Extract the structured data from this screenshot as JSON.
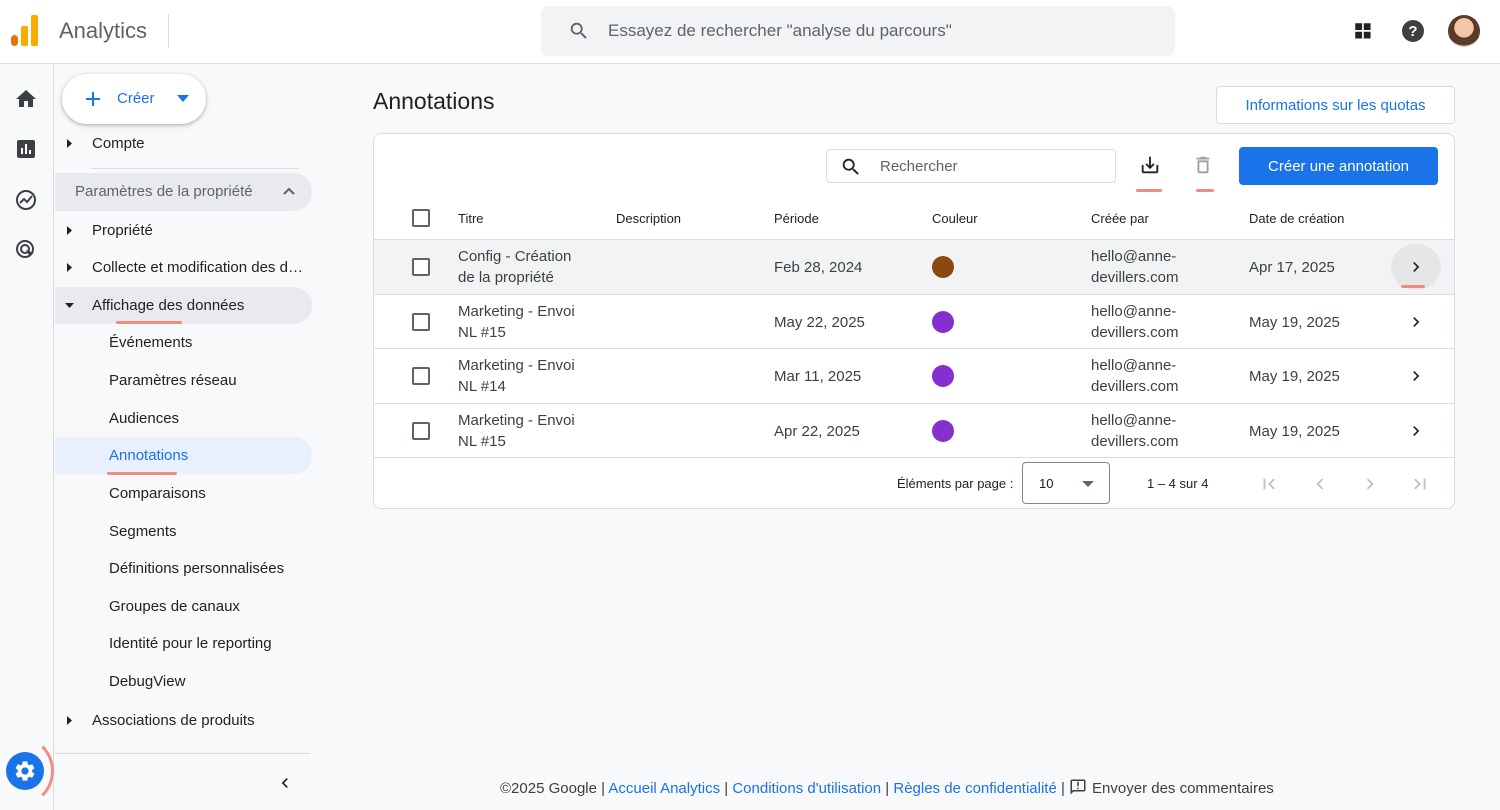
{
  "header": {
    "app_title": "Analytics",
    "search_placeholder": "Essayez de rechercher \"analyse du parcours\""
  },
  "sidebar": {
    "create_label": "Créer",
    "account": "Compte",
    "property_settings": "Paramètres de la propriété",
    "items": [
      {
        "label": "Propriété"
      },
      {
        "label": "Collecte et modification des données"
      },
      {
        "label": "Affichage des données"
      }
    ],
    "sub_items": [
      {
        "label": "Événements"
      },
      {
        "label": "Paramètres réseau"
      },
      {
        "label": "Audiences"
      },
      {
        "label": "Annotations"
      },
      {
        "label": "Comparaisons"
      },
      {
        "label": "Segments"
      },
      {
        "label": "Définitions personnalisées"
      },
      {
        "label": "Groupes de canaux"
      },
      {
        "label": "Identité pour le reporting"
      },
      {
        "label": "DebugView"
      }
    ],
    "product_links": "Associations de produits"
  },
  "main": {
    "page_title": "Annotations",
    "quota_button": "Informations sur les quotas",
    "table_search_placeholder": "Rechercher",
    "create_annotation_button": "Créer une annotation",
    "columns": [
      "Titre",
      "Description",
      "Période",
      "Couleur",
      "Créée par",
      "Date de création"
    ],
    "rows": [
      {
        "title": "Config - Création de la propriété",
        "description": "",
        "period": "Feb 28, 2024",
        "color": "#8a4a0f",
        "created_by": "hello@anne-devillers.com",
        "created_on": "Apr 17, 2025"
      },
      {
        "title": "Marketing - Envoi NL #15",
        "description": "",
        "period": "May 22, 2025",
        "color": "#8430ce",
        "created_by": "hello@anne-devillers.com",
        "created_on": "May 19, 2025"
      },
      {
        "title": "Marketing - Envoi NL #14",
        "description": "",
        "period": "Mar 11, 2025",
        "color": "#8430ce",
        "created_by": "hello@anne-devillers.com",
        "created_on": "May 19, 2025"
      },
      {
        "title": "Marketing - Envoi NL #15",
        "description": "",
        "period": "Apr 22, 2025",
        "color": "#8430ce",
        "created_by": "hello@anne-devillers.com",
        "created_on": "May 19, 2025"
      }
    ],
    "pager": {
      "label": "Éléments par page :",
      "page_size": "10",
      "range": "1 – 4 sur 4"
    }
  },
  "footer": {
    "copyright": "©2025 Google |",
    "link_home": "Accueil Analytics",
    "link_terms": "Conditions d'utilisation",
    "link_privacy": "Règles de confidentialité",
    "feedback": "Envoyer des commentaires"
  },
  "colors": {
    "accent": "#1a73e8",
    "annotation_mark": "#f28b82"
  }
}
